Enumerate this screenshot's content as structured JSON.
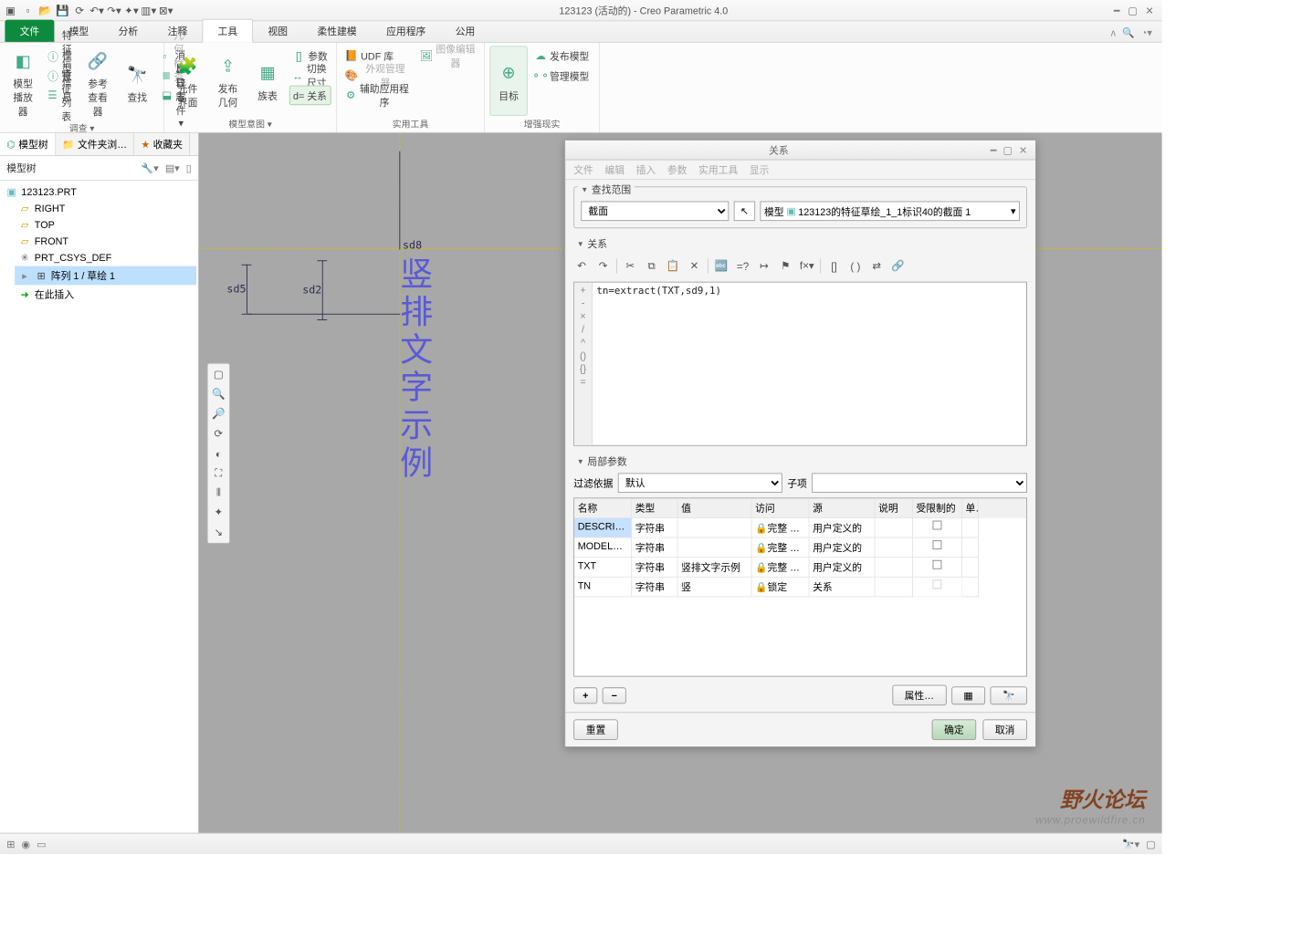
{
  "app": {
    "title": "123123 (活动的) - Creo Parametric 4.0"
  },
  "ribbonTabs": {
    "file": "文件",
    "tabs": [
      "模型",
      "分析",
      "注释",
      "工具",
      "视图",
      "柔性建模",
      "应用程序",
      "公用"
    ],
    "activeIndex": 3
  },
  "ribbon": {
    "g1": {
      "modelPlayer": "模型播放器",
      "paramViewer": "参考查看器",
      "find": "查找",
      "featInfo": "特征信息",
      "modelInfo": "模型信息",
      "featList": "特征列表",
      "geomCheck": "几何检查",
      "msgLog": "消息日志",
      "compare": "比较零件 ▾",
      "label": "调查 ▾"
    },
    "g2": {
      "componentUI": "元件界面",
      "publishGeom": "发布几何",
      "family": "族表",
      "params": "参数",
      "switchDim": "切换尺寸",
      "relations": "d= 关系",
      "label": "模型意图 ▾"
    },
    "g3": {
      "udf": "UDF 库",
      "extMgr": "外观管理器",
      "auxApp": "辅助应用程序",
      "imgEditor": "图像编辑器",
      "label": "实用工具"
    },
    "g4": {
      "target": "目标",
      "publishModel": "发布模型",
      "manageModel": "管理模型",
      "label": "增强现实"
    }
  },
  "leftTabs": {
    "modelTree": "模型树",
    "fileBrowser": "文件夹浏…",
    "fav": "收藏夹"
  },
  "tree": {
    "header": "模型树",
    "root": "123123.PRT",
    "children": [
      "RIGHT",
      "TOP",
      "FRONT",
      "PRT_CSYS_DEF",
      "阵列 1 / 草绘 1",
      "在此插入"
    ]
  },
  "canvas": {
    "dims": {
      "sd5": "sd5",
      "sd2": "sd2",
      "sd8": "sd8"
    },
    "vtext": "竖排文字示例"
  },
  "dialog": {
    "title": "关系",
    "menu": [
      "文件",
      "编辑",
      "插入",
      "参数",
      "实用工具",
      "显示"
    ],
    "scopeLabel": "查找范围",
    "scopeType": "截面",
    "scopeSel": "123123的特征草绘_1_1标识40的截面 1",
    "scopePrefix": "模型",
    "relLabel": "关系",
    "relText": "tn=extract(TXT,sd9,1)",
    "localParamsLabel": "局部参数",
    "filterBy": "过滤依据",
    "filterDefault": "默认",
    "subLabel": "子项",
    "cols": [
      "名称",
      "类型",
      "值",
      "访问",
      "源",
      "说明",
      "受限制的",
      "单"
    ],
    "rows": [
      {
        "name": "DESCRIP…",
        "type": "字符串",
        "value": "",
        "access": "🔒完整 …",
        "source": "用户定义的",
        "note": "",
        "restricted": false
      },
      {
        "name": "MODELE…",
        "type": "字符串",
        "value": "",
        "access": "🔒完整 …",
        "source": "用户定义的",
        "note": "",
        "restricted": false
      },
      {
        "name": "TXT",
        "type": "字符串",
        "value": "竖排文字示例",
        "access": "🔒完整 …",
        "source": "用户定义的",
        "note": "",
        "restricted": false
      },
      {
        "name": "TN",
        "type": "字符串",
        "value": "竖",
        "access": "🔒锁定",
        "source": "关系",
        "note": "",
        "restricted": false
      }
    ],
    "btnProps": "属性…",
    "btnReset": "重置",
    "btnOk": "确定",
    "btnCancel": "取消"
  },
  "watermark": {
    "cn": "野火论坛",
    "url": "www.proewildfire.cn"
  }
}
